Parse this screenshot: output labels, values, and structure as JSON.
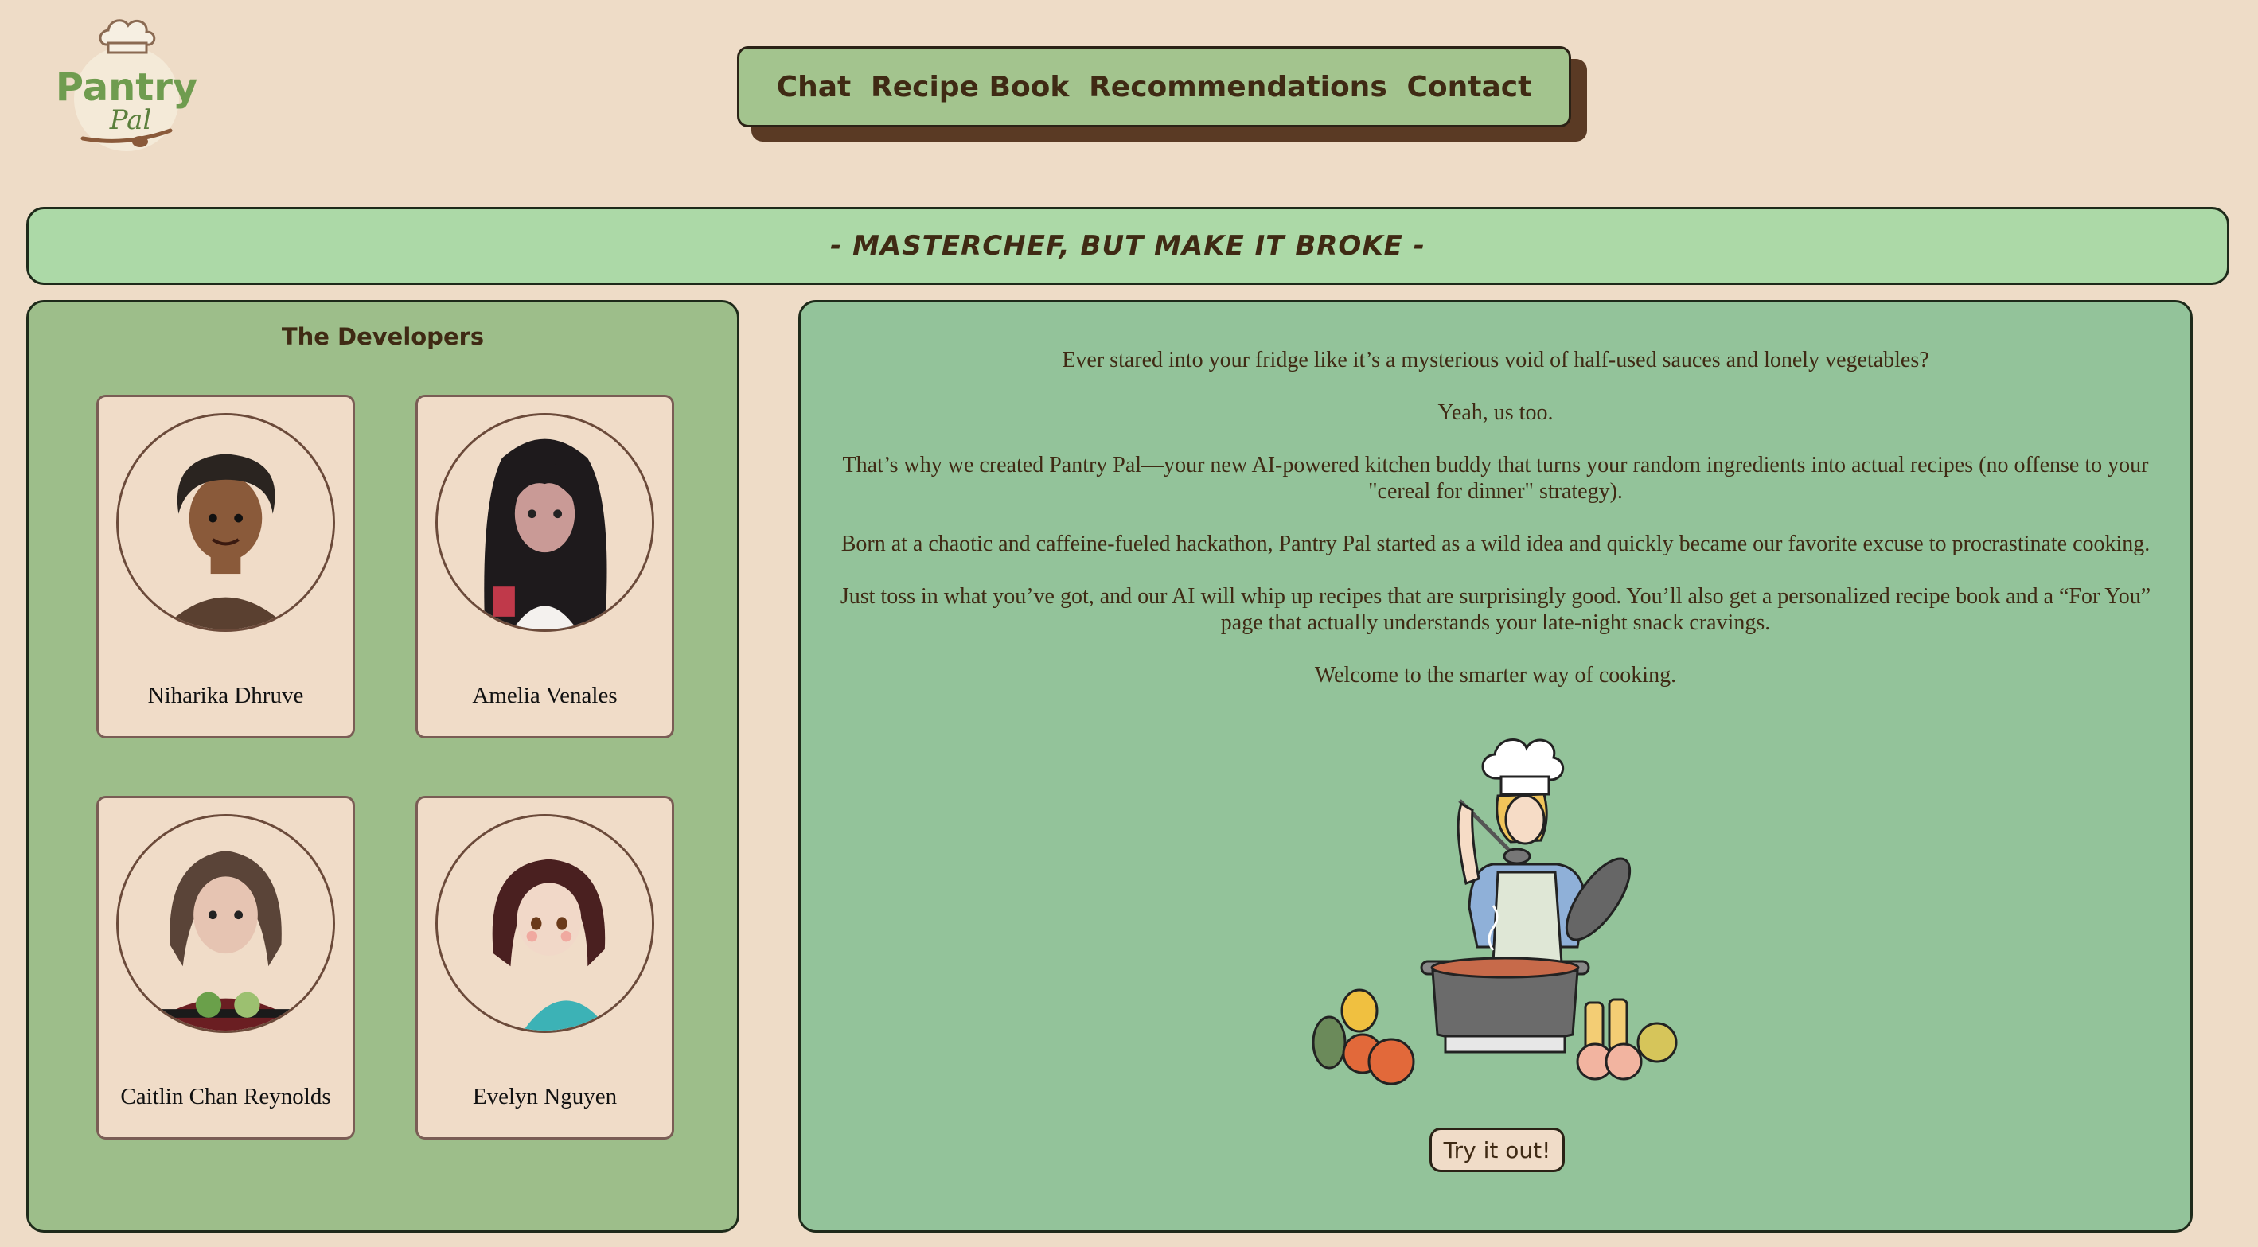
{
  "logo": {
    "line1": "Pantry",
    "line2": "Pal",
    "colors": {
      "green": "#6f9c4f",
      "brown": "#8a5a3a"
    }
  },
  "nav": {
    "items": [
      {
        "label": "Chat"
      },
      {
        "label": "Recipe Book"
      },
      {
        "label": "Recommendations"
      },
      {
        "label": "Contact"
      }
    ]
  },
  "tagline": "- MASTERCHEF, BUT MAKE IT BROKE -",
  "developers": {
    "title": "The Developers",
    "members": [
      {
        "name": "Niharika Dhruve"
      },
      {
        "name": "Amelia Venales"
      },
      {
        "name": "Caitlin Chan Reynolds"
      },
      {
        "name": "Evelyn Nguyen"
      }
    ]
  },
  "about": {
    "paragraphs": [
      "Ever stared into your fridge like it’s a mysterious void of half-used sauces and lonely vegetables?",
      "Yeah, us too.",
      "That’s why we created Pantry Pal—your new AI-powered kitchen buddy that turns your random ingredients into actual recipes (no offense to your \"cereal for dinner\" strategy).",
      "Born at a chaotic and caffeine-fueled hackathon, Pantry Pal started as a wild idea and quickly became our favorite excuse to procrastinate cooking.",
      "Just toss in what you’ve got, and our AI will whip up recipes that are surprisingly good. You’ll also get a personalized recipe book and a “For You” page that actually understands your late-night snack cravings.",
      "Welcome to the smarter way of cooking."
    ],
    "cta_label": "Try it out!"
  },
  "colors": {
    "page_bg": "#eedcc7",
    "nav_bg": "#a3c48e",
    "tagline_bg": "#acd9a7",
    "dev_panel_bg": "#9dbe8a",
    "about_panel_bg": "#93c39a",
    "text": "#3f2a14"
  }
}
